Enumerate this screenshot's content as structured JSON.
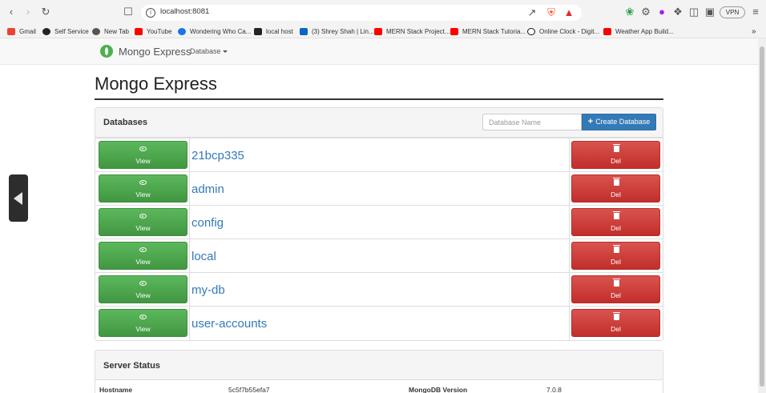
{
  "browser": {
    "url": "localhost:8081",
    "vpn_label": "VPN",
    "bookmarks": [
      {
        "label": "Gmail",
        "color": "#ea4335"
      },
      {
        "label": "Self Service",
        "color": "#222222"
      },
      {
        "label": "New Tab",
        "color": "#555555"
      },
      {
        "label": "YouTube",
        "color": "#ff0000"
      },
      {
        "label": "Wondering Who Ca...",
        "color": "#1a73e8"
      },
      {
        "label": "local host",
        "color": "#20232a"
      },
      {
        "label": "(3) Shrey Shah | Lin...",
        "color": "#0a66c2"
      },
      {
        "label": "MERN Stack Project...",
        "color": "#ff0000"
      },
      {
        "label": "MERN Stack Tutoria...",
        "color": "#ff0000"
      },
      {
        "label": "Online Clock - Digit...",
        "color": "#111111"
      },
      {
        "label": "Weather App Build...",
        "color": "#ff0000"
      }
    ],
    "more_bookmarks": "»"
  },
  "navbar": {
    "brand": "Mongo Express",
    "database_menu": "Database"
  },
  "page_title": "Mongo Express",
  "databases_panel": {
    "title": "Databases",
    "input_placeholder": "Database Name",
    "create_button": "Create Database",
    "view_label": "View",
    "delete_label": "Del",
    "databases": [
      "21bcp335",
      "admin",
      "config",
      "local",
      "my-db",
      "user-accounts"
    ]
  },
  "server_status_panel": {
    "title": "Server Status",
    "row": [
      "Hostname",
      "5c5f7b55efa7",
      "MongoDB Version",
      "7.0.8"
    ]
  },
  "colors": {
    "primary": "#337ab7",
    "success": "#5cb85c",
    "danger": "#d9534f"
  }
}
